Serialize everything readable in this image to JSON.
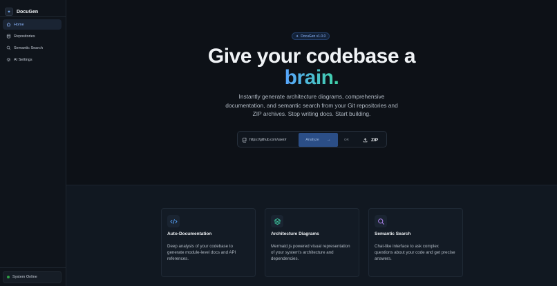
{
  "app": {
    "name": "DocuGen"
  },
  "sidebar": {
    "items": [
      {
        "label": "Home",
        "icon": "home-icon",
        "active": true
      },
      {
        "label": "Repositories",
        "icon": "database-icon",
        "active": false
      },
      {
        "label": "Semantic Search",
        "icon": "search-icon",
        "active": false
      },
      {
        "label": "AI Settings",
        "icon": "gear-icon",
        "active": false
      }
    ],
    "status": "System Online"
  },
  "hero": {
    "badge": "DocuGen v1.0.0",
    "title_main": "Give your codebase a",
    "title_accent": "brain.",
    "subtitle": "Instantly generate architecture diagrams, comprehensive documentation, and semantic search from your Git repositories and ZIP archives. Stop writing docs. Start building.",
    "input_value": "https://github.com/user/r",
    "analyze_label": "Analyze",
    "or_label": "OR",
    "zip_label": "ZIP"
  },
  "features": [
    {
      "title": "Auto-Documentation",
      "desc": "Deep analysis of your codebase to generate module-level docs and API references.",
      "icon": "code-icon",
      "color": "#58a6ff"
    },
    {
      "title": "Architecture Diagrams",
      "desc": "Mermaid.js powered visual representation of your system's architecture and dependencies.",
      "icon": "layers-icon",
      "color": "#3fd3a6"
    },
    {
      "title": "Semantic Search",
      "desc": "Chat-like interface to ask complex questions about your code and get precise answers.",
      "icon": "search-icon",
      "color": "#bc8cff"
    }
  ],
  "colors": {
    "accent_blue": "#58a6ff",
    "accent_teal": "#3fd3a6",
    "online": "#2ea043"
  }
}
